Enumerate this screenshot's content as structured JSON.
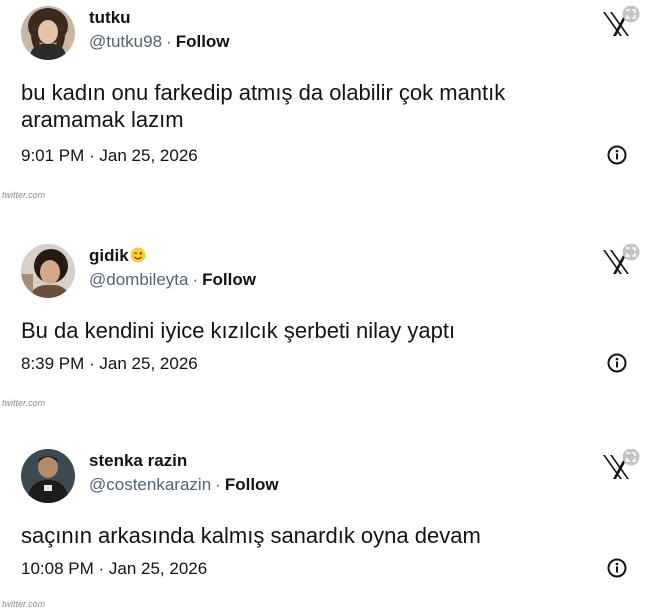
{
  "tweets": [
    {
      "name": "tutku",
      "handle": "@tutku98",
      "separator": "·",
      "follow_label": "Follow",
      "text": "bu kadın onu farkedip atmış da olabilir çok mantık aramamak lazım",
      "time": "9:01 PM",
      "date": "Jan 25, 2026",
      "source": "twitter.com",
      "avatar_icon": "avatar-photo"
    },
    {
      "name": "gidik",
      "name_emoji": "winking-face-emoji",
      "handle": "@dombileyta",
      "separator": "·",
      "follow_label": "Follow",
      "text": "Bu da kendini iyice kızılcık şerbeti nilay yaptı",
      "time": "8:39 PM",
      "date": "Jan 25, 2026",
      "source": "twitter.com",
      "avatar_icon": "avatar-photo"
    },
    {
      "name": "stenka razin",
      "handle": "@costenkarazin",
      "separator": "·",
      "follow_label": "Follow",
      "text": "saçının arkasında kalmış sanardık oyna devam",
      "time": "10:08 PM",
      "date": "Jan 25, 2026",
      "source": "twitter.com",
      "avatar_icon": "avatar-photo"
    }
  ],
  "icons": {
    "brand": "x-logo-icon",
    "info": "info-icon",
    "overlay": "expand-badge-icon"
  },
  "colors": {
    "text": "#0f1419",
    "muted": "#536471",
    "source": "#8a8f94"
  }
}
